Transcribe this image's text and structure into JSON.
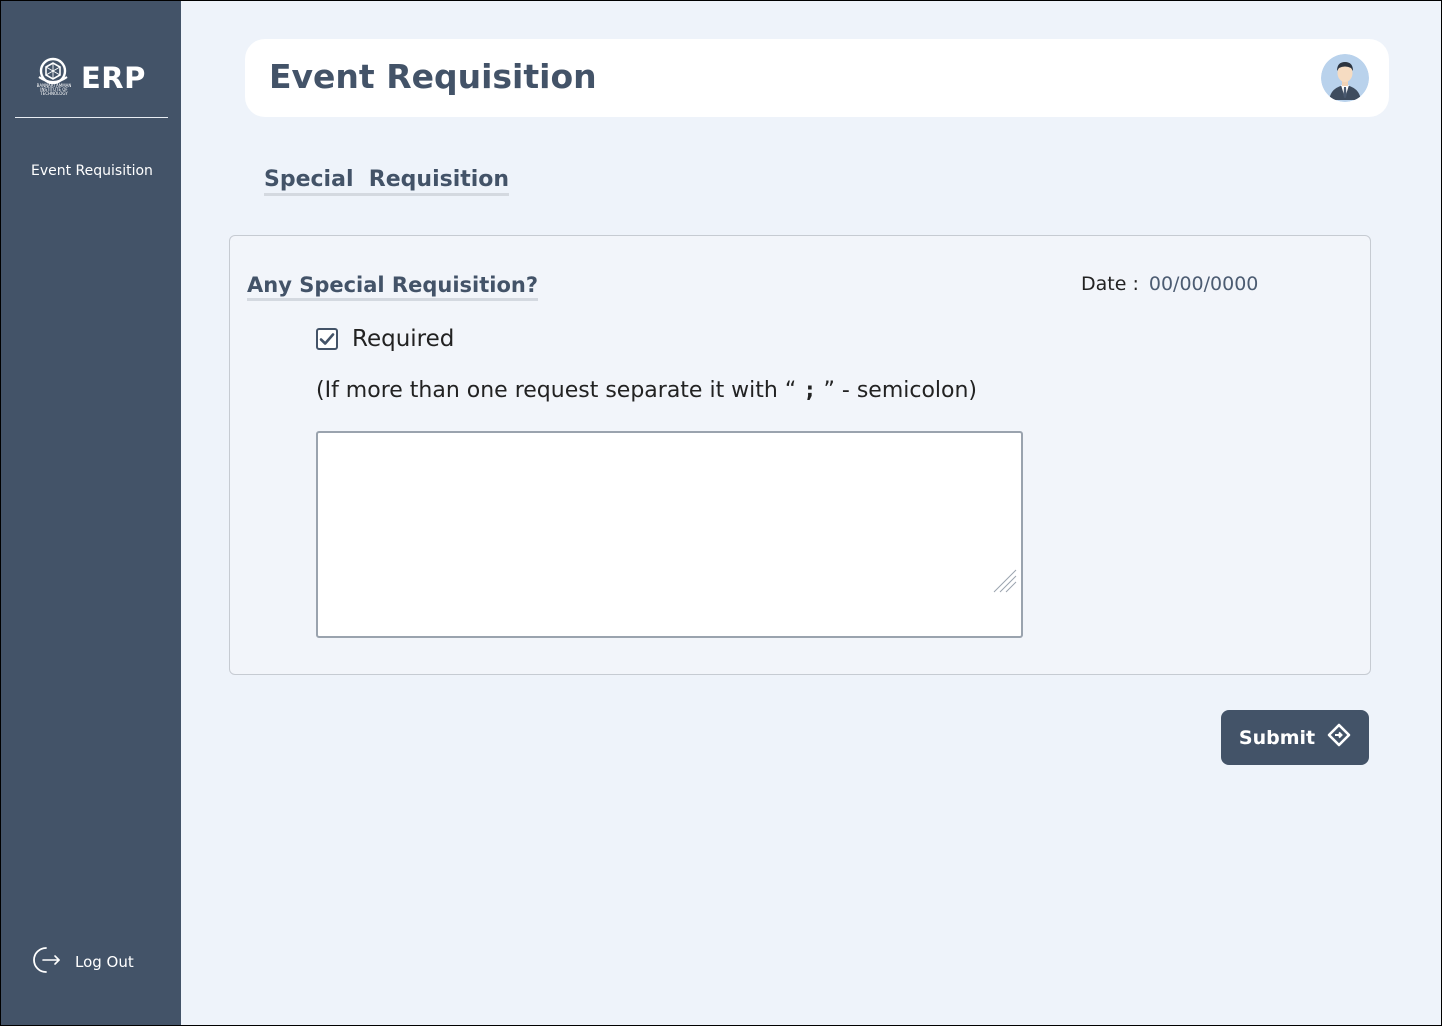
{
  "app": {
    "logo_text": "ERP",
    "logo_emblem_text": "BANNARI AMMAN INSTITUTE OF TECHNOLOGY"
  },
  "sidebar": {
    "items": [
      {
        "label": "Event Requisition"
      }
    ],
    "logout_label": "Log Out"
  },
  "header": {
    "title": "Event Requisition",
    "avatar_icon": "user-avatar-icon"
  },
  "section": {
    "title": "Special  Requisition"
  },
  "card": {
    "question": "Any Special Requisition?",
    "date_label": "Date :",
    "date_value": "00/00/0000",
    "required_label": "Required",
    "required_checked": true,
    "hint_prefix": "(If more than one request separate it with “ ",
    "hint_semicolon": ";",
    "hint_suffix": " ” - semicolon)",
    "textarea_value": ""
  },
  "actions": {
    "submit_label": "Submit",
    "submit_icon": "diamond-arrow-icon"
  },
  "colors": {
    "sidebar_bg": "#435368",
    "page_bg": "#eef3fa",
    "accent": "#435368"
  }
}
